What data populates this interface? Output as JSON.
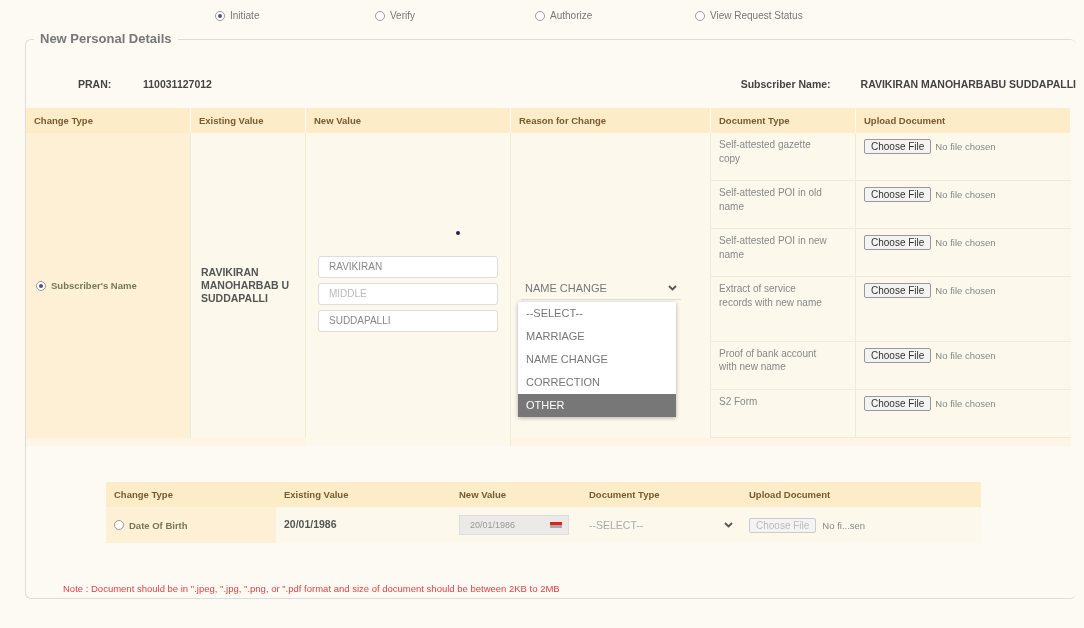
{
  "steps": [
    {
      "label": "Initiate",
      "selected": true
    },
    {
      "label": "Verify",
      "selected": false
    },
    {
      "label": "Authorize",
      "selected": false
    },
    {
      "label": "View Request Status",
      "selected": false
    }
  ],
  "section_title": "New Personal Details",
  "pran": {
    "label": "PRAN:",
    "value": "110031127012"
  },
  "subscriber": {
    "label": "Subscriber Name:",
    "value": "RAVIKIRAN MANOHARBABU SUDDAPALLI"
  },
  "main_table": {
    "columns": [
      "Change Type",
      "Existing Value",
      "New Value",
      "Reason for Change",
      "Document Type",
      "Upload Document"
    ],
    "row": {
      "change_type": "Subscriber's Name",
      "selected": true,
      "existing_value": "RAVIKIRAN MANOHARBAB U SUDDAPALLI",
      "new_values": [
        {
          "value": "RAVIKIRAN"
        },
        {
          "placeholder": "MIDDLE"
        },
        {
          "value": "SUDDAPALLI"
        }
      ],
      "reason": {
        "value": "NAME CHANGE",
        "expanded": true,
        "options": [
          {
            "label": "--SELECT--",
            "highlighted": false
          },
          {
            "label": "MARRIAGE",
            "highlighted": false
          },
          {
            "label": "NAME CHANGE",
            "highlighted": false
          },
          {
            "label": "CORRECTION",
            "highlighted": false
          },
          {
            "label": "OTHER",
            "highlighted": true
          }
        ]
      },
      "documents": [
        {
          "type": "Self-attested gazette copy",
          "button": "Choose File",
          "file_status": "No file chosen"
        },
        {
          "type": "Self-attested POI in old name",
          "button": "Choose File",
          "file_status": "No file chosen"
        },
        {
          "type": "Self-attested POI in new name",
          "button": "Choose File",
          "file_status": "No file chosen"
        },
        {
          "type": "Extract of service records with new name",
          "button": "Choose File",
          "file_status": "No file chosen"
        },
        {
          "type": "Proof of bank account with new name",
          "button": "Choose File",
          "file_status": "No file chosen"
        },
        {
          "type": "S2 Form",
          "button": "Choose File",
          "file_status": "No file chosen"
        }
      ]
    }
  },
  "dob_table": {
    "columns": [
      "Change Type",
      "Existing Value",
      "New Value",
      "Document Type",
      "Upload Document"
    ],
    "row": {
      "change_type": "Date Of Birth",
      "selected": false,
      "existing_value": "20/01/1986",
      "new_value": "20/01/1986",
      "document_type": "--SELECT--",
      "button": "Choose File",
      "disabled": true,
      "file_status": "No fi...sen"
    }
  },
  "note": "Note : Document should be in \".jpeg, \".jpg, \".png, or \".pdf format and size of document should be between 2KB to 2MB"
}
